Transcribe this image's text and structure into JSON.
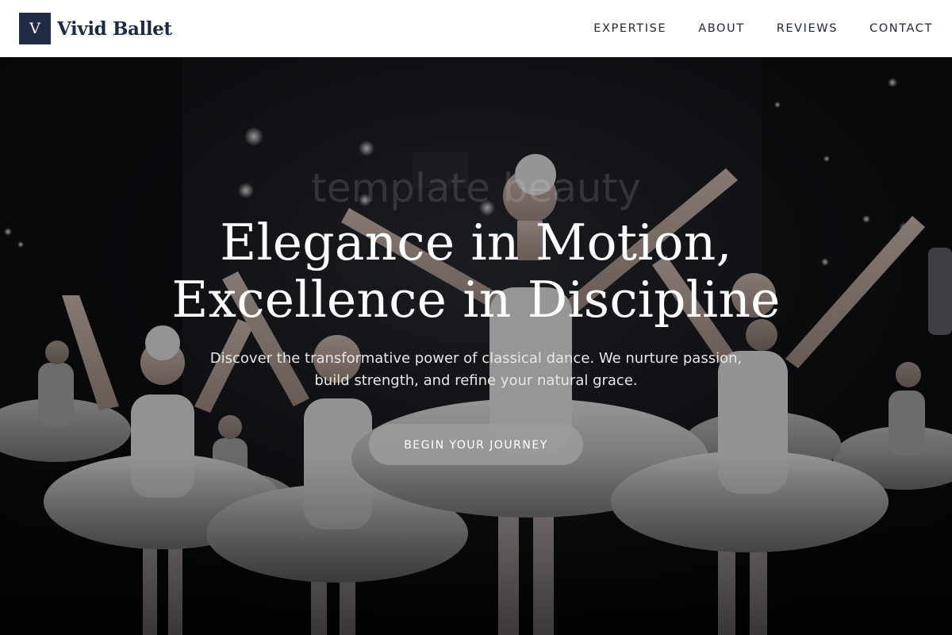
{
  "brand": {
    "mark": "V",
    "name": "Vivid Ballet"
  },
  "nav": {
    "items": [
      {
        "label": "EXPERTISE"
      },
      {
        "label": "ABOUT"
      },
      {
        "label": "REVIEWS"
      },
      {
        "label": "CONTACT"
      }
    ]
  },
  "hero": {
    "title_line1": "Elegance in Motion,",
    "title_line2": "Excellence in Discipline",
    "subtitle": "Discover the transformative power of classical dance. We nurture passion, build strength, and refine your natural grace.",
    "cta_label": "BEGIN YOUR JOURNEY",
    "watermark": "template beauty"
  },
  "colors": {
    "brand_navy": "#1f2a44",
    "header_bg": "#ffffff",
    "hero_overlay": "rgba(0,0,0,0.38)",
    "cta_bg": "#9b9b9b"
  },
  "icons": {
    "logo": "letter-v-logo-icon"
  }
}
